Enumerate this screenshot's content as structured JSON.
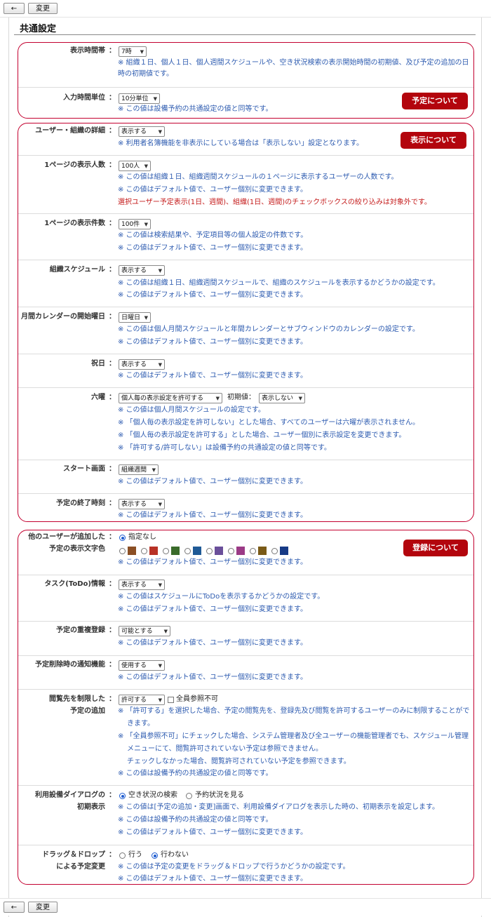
{
  "toolbar": {
    "back_icon": "←",
    "save_label": "変更"
  },
  "page_title": "共通設定",
  "colors": {
    "accent_red": "#c3002f",
    "note_blue": "#2d5bb0",
    "pill_red": "#b3050d"
  },
  "buttons": {
    "schedule_about": "予定について",
    "display_about": "表示について",
    "register_about": "登録について"
  },
  "s1": {
    "label": "表示時間帯",
    "value": "7時",
    "note1": "※ 組織１日、個人１日、個人週間スケジュールや、空き状況検索の表示開始時間の初期値、及び予定の追加の日",
    "note2": "時の初期値です。"
  },
  "s2": {
    "label": "入力時間単位",
    "value": "10分単位",
    "note1": "※ この値は設備予約の共通設定の値と同等です。"
  },
  "s3": {
    "label": "ユーザー・組織の詳細",
    "value": "表示する",
    "note1": "※ 利用者名簿機能を非表示にしている場合は「表示しない」設定となります。"
  },
  "s4": {
    "label": "1ページの表示人数",
    "value": "100人",
    "note1": "※ この値は組織１日、組織週間スケジュールの１ページに表示するユーザーの人数です。",
    "note2": "※ この値はデフォルト値で、ユーザー個別に変更できます。",
    "note3": "選択ユーザー予定表示(1日、週間)、組織(1日、週間)のチェックボックスの絞り込みは対象外です。"
  },
  "s5": {
    "label": "1ページの表示件数",
    "value": "100件",
    "note1": "※ この値は検索結果や、予定項目等の個人設定の件数です。",
    "note2": "※ この値はデフォルト値で、ユーザー個別に変更できます。"
  },
  "s6": {
    "label": "組織スケジュール",
    "value": "表示する",
    "note1": "※ この値は組織１日、組織週間スケジュールで、組織のスケジュールを表示するかどうかの設定です。",
    "note2": "※ この値はデフォルト値で、ユーザー個別に変更できます。"
  },
  "s7": {
    "label": "月間カレンダーの開始曜日",
    "value": "日曜日",
    "note1": "※ この値は個人月間スケジュールと年間カレンダーとサブウィンドウのカレンダーの設定です。",
    "note2": "※ この値はデフォルト値で、ユーザー個別に変更できます。"
  },
  "s8": {
    "label": "祝日",
    "value": "表示する",
    "note1": "※ この値はデフォルト値で、ユーザー個別に変更できます。"
  },
  "s9": {
    "label": "六曜",
    "value": "個人毎の表示設定を許可する",
    "initial_label": "初期値：",
    "initial_value": "表示しない",
    "note1": "※ この値は個人月間スケジュールの設定です。",
    "note2": "※ 「個人毎の表示設定を許可しない」とした場合、すべてのユーザーは六曜が表示されません。",
    "note3": "※ 「個人毎の表示設定を許可する」とした場合、ユーザー個別に表示設定を変更できます。",
    "note4": "※ 「許可する/許可しない」は設備予約の共通設定の値と同等です。"
  },
  "s10": {
    "label": "スタート画面",
    "value": "組織週間",
    "note1": "※ この値はデフォルト値で、ユーザー個別に変更できます。"
  },
  "s11": {
    "label": "予定の終了時刻",
    "value": "表示する",
    "note1": "※ この値はデフォルト値で、ユーザー個別に変更できます。"
  },
  "s12": {
    "label1": "他のユーザーが追加した",
    "label2": "予定の表示文字色",
    "option_none": "指定なし",
    "swatches": [
      "#8b4f24",
      "#b83226",
      "#3a6b2b",
      "#1f5a96",
      "#6a4f9a",
      "#9b3a86",
      "#7a5a17",
      "#173a86"
    ],
    "note1": "※ この値はデフォルト値で、ユーザー個別に変更できます。"
  },
  "s13": {
    "label": "タスク(ToDo)情報",
    "value": "表示する",
    "note1": "※ この値はスケジュールにToDoを表示するかどうかの設定です。",
    "note2": "※ この値はデフォルト値で、ユーザー個別に変更できます。"
  },
  "s14": {
    "label": "予定の重複登録",
    "value": "可能とする",
    "note1": "※ この値はデフォルト値で、ユーザー個別に変更できます。"
  },
  "s15": {
    "label": "予定削除時の通知機能",
    "value": "使用する",
    "note1": "※ この値はデフォルト値で、ユーザー個別に変更できます。"
  },
  "s16": {
    "label1": "閲覧先を制限した",
    "label2": "予定の追加",
    "value": "許可する",
    "checkbox_label": "全員参照不可",
    "note1": "※ 「許可する」を選択した場合、予定の閲覧先を、登録先及び閲覧を許可するユーザーのみに制限することがで",
    "note2": "きます。",
    "note3": "※ 「全員参照不可」にチェックした場合、システム管理者及び全ユーザーの機能管理者でも、スケジュール管理",
    "note4": "メニューにて、閲覧許可されていない予定は参照できません。",
    "note5": "チェックしなかった場合、閲覧許可されていない予定を参照できます。",
    "note6": "※ この値は設備予約の共通設定の値と同等です。"
  },
  "s17": {
    "label1": "利用設備ダイアログの",
    "label2": "初期表示",
    "option1": "空き状況の検索",
    "option2": "予約状況を見る",
    "note1": "※ この値は[予定の追加・変更]画面で、利用設備ダイアログを表示した時の、初期表示を設定します。",
    "note2": "※ この値は設備予約の共通設定の値と同等です。",
    "note3": "※ この値はデフォルト値で、ユーザー個別に変更できます。"
  },
  "s18": {
    "label1": "ドラッグ＆ドロップ",
    "label2": "による予定変更",
    "option1": "行う",
    "option2": "行わない",
    "note1": "※ この値は予定の変更をドラッグ＆ドロップで行うかどうかの設定です。",
    "note2": "※ この値はデフォルト値で、ユーザー個別に変更できます。"
  },
  "colon": "："
}
